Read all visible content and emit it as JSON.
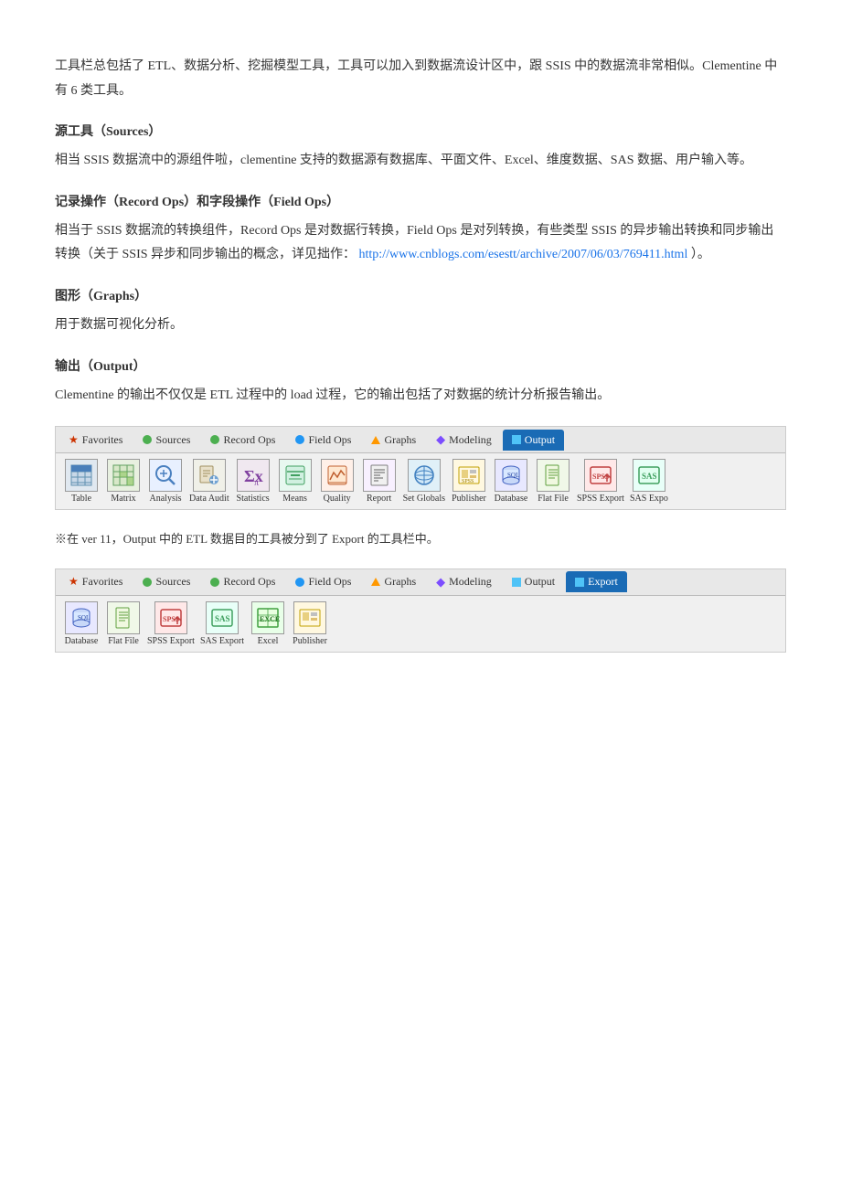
{
  "intro_paragraph": "工具栏总包括了 ETL、数据分析、挖掘模型工具，工具可以加入到数据流设计区中，跟 SSIS 中的数据流非常相似。Clementine 中有 6 类工具。",
  "section1": {
    "title": "源工具（Sources）",
    "body": "相当 SSIS 数据流中的源组件啦，clementine 支持的数据源有数据库、平面文件、Excel、维度数据、SAS 数据、用户输入等。"
  },
  "section2": {
    "title": "记录操作（Record Ops）和字段操作（Field Ops）",
    "body1": "相当于 SSIS 数据流的转换组件，Record Ops 是对数据行转换，Field Ops 是对列转换，有些类型 SSIS 的异步输出转换和同步输出转换（关于 SSIS 异步和同步输出的概念，详见拙作：",
    "link_text": "http://www.cnblogs.com/esestt/archive/2007/06/03/769411.html",
    "link_url": "http://www.cnblogs.com/esestt/archive/2007/06/03/769411.html",
    "body2": "）。"
  },
  "section3": {
    "title": "图形（Graphs）",
    "body": "用于数据可视化分析。"
  },
  "section4": {
    "title": "输出（Output）",
    "body": "Clementine 的输出不仅仅是 ETL 过程中的 load 过程，它的输出包括了对数据的统计分析报告输出。"
  },
  "toolbar1": {
    "tabs": [
      {
        "id": "favorites",
        "label": "Favorites",
        "type": "star",
        "active": false
      },
      {
        "id": "sources",
        "label": "Sources",
        "dot": "green",
        "active": false
      },
      {
        "id": "recordops",
        "label": "Record Ops",
        "dot": "green",
        "active": false
      },
      {
        "id": "fieldops",
        "label": "Field Ops",
        "dot": "blue",
        "active": false
      },
      {
        "id": "graphs",
        "label": "Graphs",
        "dot": "orange",
        "active": false
      },
      {
        "id": "modeling",
        "label": "Modeling",
        "dot": "purple",
        "active": false
      },
      {
        "id": "output",
        "label": "Output",
        "dot": "blue",
        "active": true
      }
    ],
    "tools": [
      {
        "id": "table",
        "label": "Table"
      },
      {
        "id": "matrix",
        "label": "Matrix"
      },
      {
        "id": "analysis",
        "label": "Analysis"
      },
      {
        "id": "dataaudit",
        "label": "Data Audit"
      },
      {
        "id": "statistics",
        "label": "Statistics"
      },
      {
        "id": "means",
        "label": "Means"
      },
      {
        "id": "quality",
        "label": "Quality"
      },
      {
        "id": "report",
        "label": "Report"
      },
      {
        "id": "setglobals",
        "label": "Set Globals"
      },
      {
        "id": "publisher",
        "label": "Publisher"
      },
      {
        "id": "database",
        "label": "Database"
      },
      {
        "id": "flatfile",
        "label": "Flat File"
      },
      {
        "id": "spssexport",
        "label": "SPSS Export"
      },
      {
        "id": "sasexport",
        "label": "SAS Expo"
      }
    ]
  },
  "note": "※在 ver 11，Output 中的 ETL 数据目的工具被分到了 Export 的工具栏中。",
  "toolbar2": {
    "tabs": [
      {
        "id": "favorites",
        "label": "Favorites",
        "type": "star",
        "active": false
      },
      {
        "id": "sources",
        "label": "Sources",
        "dot": "green",
        "active": false
      },
      {
        "id": "recordops",
        "label": "Record Ops",
        "dot": "green",
        "active": false
      },
      {
        "id": "fieldops",
        "label": "Field Ops",
        "dot": "blue",
        "active": false
      },
      {
        "id": "graphs",
        "label": "Graphs",
        "dot": "orange",
        "active": false
      },
      {
        "id": "modeling",
        "label": "Modeling",
        "dot": "purple",
        "active": false
      },
      {
        "id": "output",
        "label": "Output",
        "dot": "blue",
        "active": false
      },
      {
        "id": "export",
        "label": "Export",
        "dot": "blue",
        "active": true
      }
    ],
    "tools": [
      {
        "id": "database",
        "label": "Database"
      },
      {
        "id": "flatfile",
        "label": "Flat File"
      },
      {
        "id": "spssexport",
        "label": "SPSS Export"
      },
      {
        "id": "sasexport",
        "label": "SAS Export"
      },
      {
        "id": "excel",
        "label": "Excel"
      },
      {
        "id": "publisher",
        "label": "Publisher"
      }
    ]
  }
}
